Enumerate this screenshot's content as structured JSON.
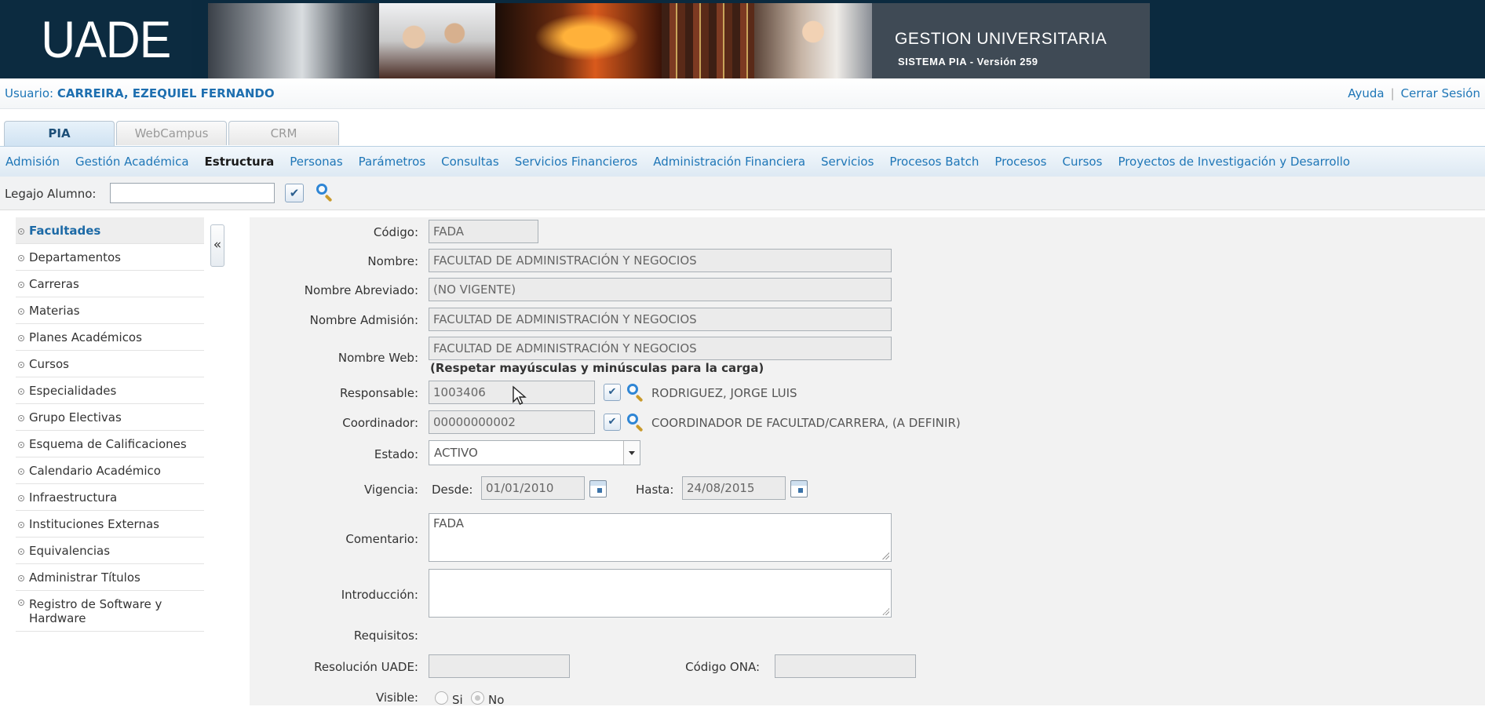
{
  "banner": {
    "logo": "UADE",
    "title": "GESTION UNIVERSITARIA",
    "subtitle": "SISTEMA PIA - Versión 259"
  },
  "user": {
    "label": "Usuario:",
    "name": "CARREIRA, EZEQUIEL FERNANDO",
    "help_link": "Ayuda",
    "separator": "|",
    "logout_link": "Cerrar Sesión"
  },
  "tabs": [
    {
      "label": "PIA",
      "active": true
    },
    {
      "label": "WebCampus",
      "active": false
    },
    {
      "label": "CRM",
      "active": false
    }
  ],
  "menu": [
    {
      "label": "Admisión"
    },
    {
      "label": "Gestión Académica"
    },
    {
      "label": "Estructura",
      "active": true
    },
    {
      "label": "Personas"
    },
    {
      "label": "Parámetros"
    },
    {
      "label": "Consultas"
    },
    {
      "label": "Servicios Financieros"
    },
    {
      "label": "Administración Financiera"
    },
    {
      "label": "Servicios"
    },
    {
      "label": "Procesos Batch"
    },
    {
      "label": "Procesos"
    },
    {
      "label": "Cursos"
    },
    {
      "label": "Proyectos de Investigación y Desarrollo"
    }
  ],
  "legajo": {
    "label": "Legajo Alumno:",
    "value": ""
  },
  "sidebar": {
    "collapse_label": "«",
    "items": [
      {
        "label": "Facultades",
        "active": true
      },
      {
        "label": "Departamentos"
      },
      {
        "label": "Carreras"
      },
      {
        "label": "Materias"
      },
      {
        "label": "Planes Académicos"
      },
      {
        "label": "Cursos"
      },
      {
        "label": "Especialidades"
      },
      {
        "label": "Grupo Electivas"
      },
      {
        "label": "Esquema de Calificaciones"
      },
      {
        "label": "Calendario Académico"
      },
      {
        "label": "Infraestructura"
      },
      {
        "label": "Instituciones Externas"
      },
      {
        "label": "Equivalencias"
      },
      {
        "label": "Administrar Títulos"
      },
      {
        "label": "Registro de Software y Hardware"
      }
    ]
  },
  "form": {
    "codigo": {
      "label": "Código:",
      "value": "FADA"
    },
    "nombre": {
      "label": "Nombre:",
      "value": "FACULTAD DE ADMINISTRACIÓN Y NEGOCIOS"
    },
    "nombre_abreviado": {
      "label": "Nombre Abreviado:",
      "value": "(NO VIGENTE)"
    },
    "nombre_admision": {
      "label": "Nombre Admisión:",
      "value": "FACULTAD DE ADMINISTRACIÓN Y NEGOCIOS"
    },
    "nombre_web": {
      "label": "Nombre Web:",
      "value": "FACULTAD DE ADMINISTRACIÓN Y NEGOCIOS",
      "note": "(Respetar mayúsculas y minúsculas para la carga)"
    },
    "responsable": {
      "label": "Responsable:",
      "value": "1003406",
      "name": "RODRIGUEZ, JORGE LUIS"
    },
    "coordinador": {
      "label": "Coordinador:",
      "value": "00000000002",
      "name": "COORDINADOR DE FACULTAD/CARRERA, (A DEFINIR)"
    },
    "estado": {
      "label": "Estado:",
      "value": "ACTIVO"
    },
    "vigencia": {
      "label": "Vigencia:",
      "desde_label": "Desde:",
      "desde": "01/01/2010",
      "hasta_label": "Hasta:",
      "hasta": "24/08/2015"
    },
    "comentario": {
      "label": "Comentario:",
      "value": "FADA"
    },
    "introduccion": {
      "label": "Introducción:",
      "value": ""
    },
    "requisitos": {
      "label": "Requisitos:"
    },
    "resolucion": {
      "label": "Resolución UADE:",
      "value": ""
    },
    "codigo_ona": {
      "label": "Código ONA:",
      "value": ""
    },
    "visible": {
      "label": "Visible:",
      "si": "Si",
      "no": "No",
      "selected": "No"
    }
  },
  "colors": {
    "banner": "#0b2a3f",
    "link": "#1e76b7",
    "menu_bg": "#dde9f3",
    "form_bg": "#f2f2f2"
  }
}
